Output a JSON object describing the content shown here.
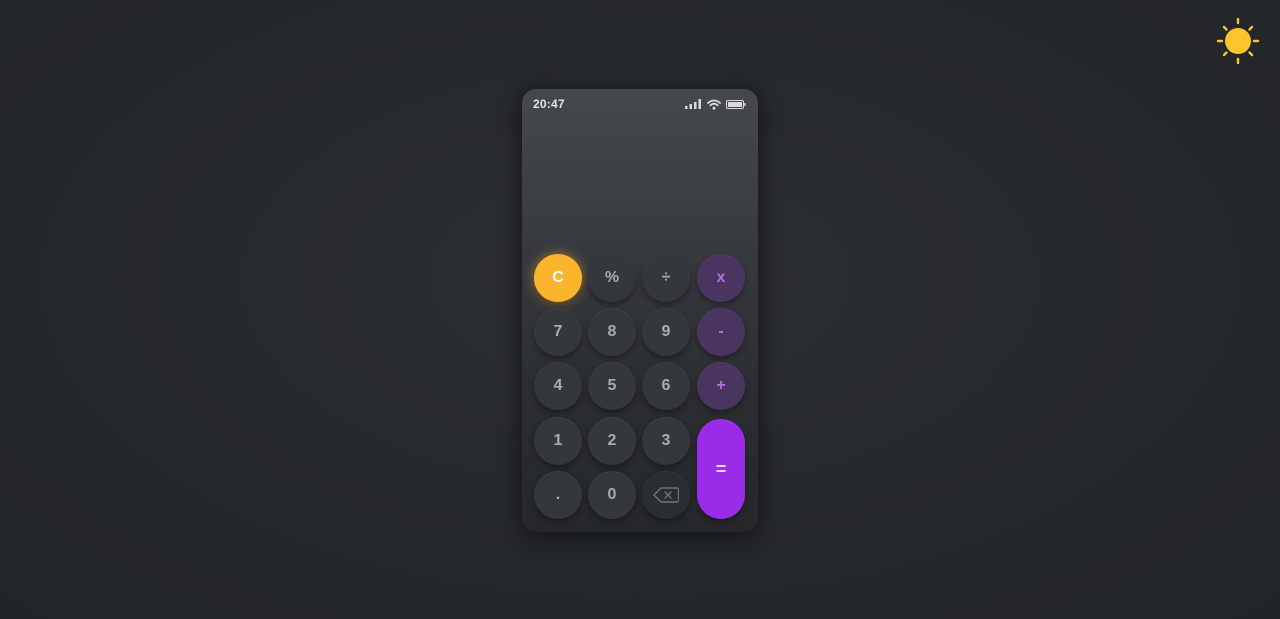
{
  "status_bar": {
    "time": "20:47",
    "signal_icon": "signal-bars-icon",
    "wifi_icon": "wifi-icon",
    "battery_icon": "battery-icon"
  },
  "theme_toggle": {
    "icon": "sun-icon",
    "color": "#fbc52c"
  },
  "display": {
    "value": ""
  },
  "keys": {
    "clear": "C",
    "percent": "%",
    "divide": "÷",
    "multiply": "x",
    "seven": "7",
    "eight": "8",
    "nine": "9",
    "minus": "-",
    "four": "4",
    "five": "5",
    "six": "6",
    "plus": "+",
    "one": "1",
    "two": "2",
    "three": "3",
    "equals": "=",
    "decimal": ".",
    "zero": "0",
    "backspace_icon": "backspace-icon"
  },
  "colors": {
    "clear_accent": "#fbb52c",
    "operator_text": "#b86fe8",
    "operator_bg": "#4a3460",
    "equals_bg": "#9a2be8",
    "sun": "#fbc52c"
  }
}
